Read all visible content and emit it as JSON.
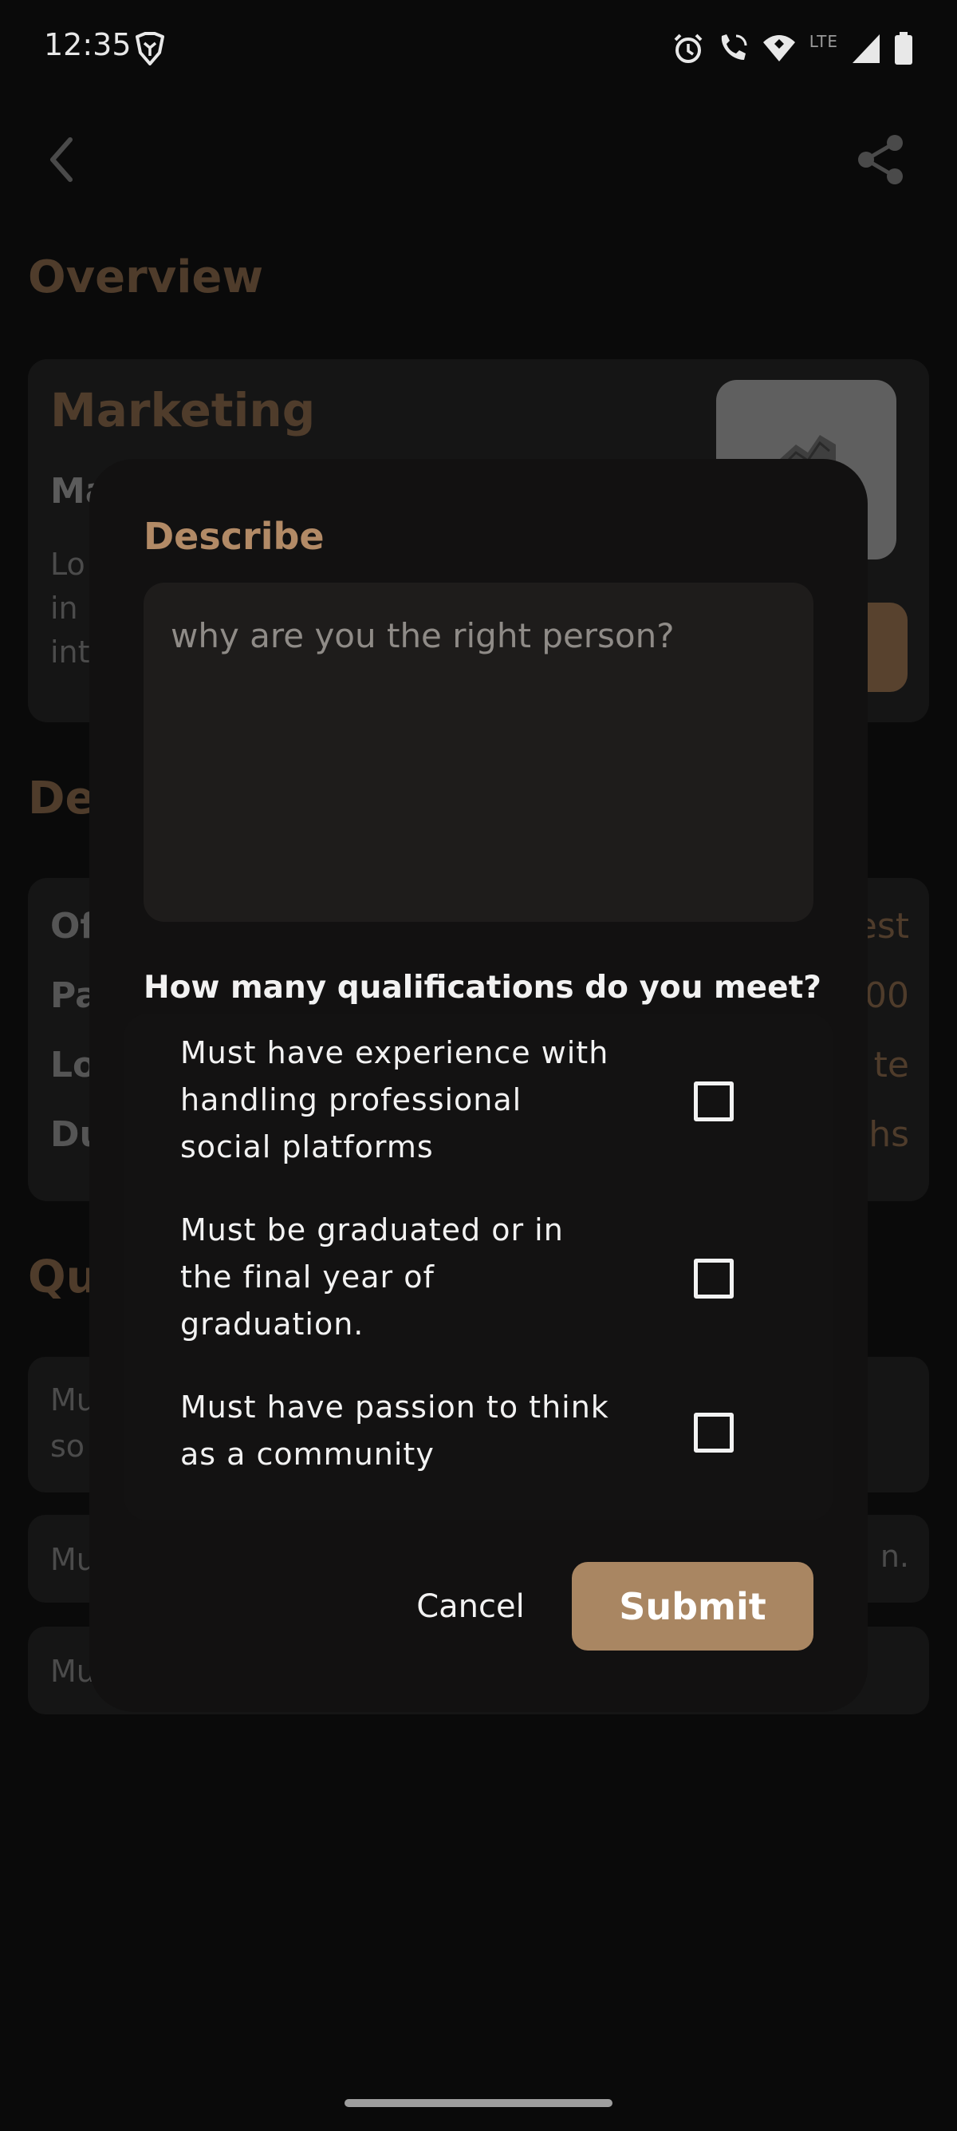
{
  "status_bar": {
    "time": "12:35",
    "network_label": "LTE",
    "icons": [
      "brave-icon",
      "alarm-icon",
      "wifi-calling-icon",
      "wifi-icon",
      "signal-icon",
      "battery-icon"
    ]
  },
  "header": {
    "back_icon": "chevron-left-icon",
    "share_icon": "share-icon"
  },
  "overview": {
    "section_title": "Overview",
    "job_title": "Marketing",
    "company_fragment": "Ma",
    "description_fragments": [
      "Lo",
      "in",
      "int"
    ]
  },
  "details": {
    "section_title_fragment": "De",
    "rows": [
      {
        "label_fragment": "Of",
        "value_fragment": "est"
      },
      {
        "label_fragment": "Pa",
        "value_fragment": "00"
      },
      {
        "label_fragment": "Lo",
        "value_fragment": "te"
      },
      {
        "label_fragment": "Du",
        "value_fragment": "hs"
      }
    ]
  },
  "qualifications": {
    "section_title_fragment": "Qu",
    "cards": [
      {
        "line1": "Mu",
        "line2": "so",
        "right_fragment": ""
      },
      {
        "line1": "Mu",
        "line2": "",
        "right_fragment": "n."
      },
      {
        "line1": "Mu",
        "line2": "",
        "right_fragment": ""
      }
    ]
  },
  "dialog": {
    "heading": "Describe",
    "textarea_placeholder": "why are you the right person?",
    "question": "How many qualifications do you meet?",
    "qualifications": [
      {
        "lines": [
          "Must have experience with",
          "handling professional",
          "social platforms"
        ],
        "checked": false
      },
      {
        "lines": [
          "Must be graduated or in",
          "the final year of",
          "graduation."
        ],
        "checked": false
      },
      {
        "lines": [
          "Must have passion to think",
          "as a community"
        ],
        "checked": false
      }
    ],
    "cancel_label": "Cancel",
    "submit_label": "Submit"
  },
  "colors": {
    "accent": "#a98662",
    "accent_dimmed": "#4f3c2b",
    "dialog_bg": "#121111",
    "page_bg": "#0a0a0a"
  }
}
